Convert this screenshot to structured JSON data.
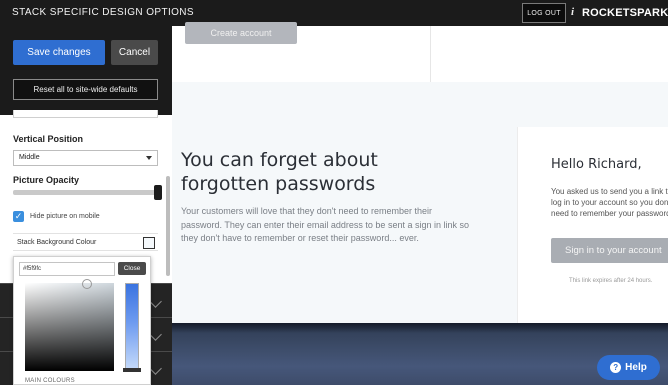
{
  "topbar": {
    "title": "STACK SPECIFIC DESIGN OPTIONS",
    "logout_label": "LOG OUT",
    "info_icon": "i",
    "brand": "ROCKETSPARK"
  },
  "sidebar": {
    "save_label": "Save changes",
    "cancel_label": "Cancel",
    "reset_label": "Reset all to site-wide defaults",
    "vertical_position_label": "Vertical Position",
    "vertical_position_value": "Middle",
    "picture_opacity_label": "Picture Opacity",
    "picture_opacity_value": 1.0,
    "hide_on_mobile_label": "Hide picture on mobile",
    "hide_on_mobile_checked": true,
    "stack_bg_label": "Stack Background Colour",
    "stack_bg_color": "#f5f9fc"
  },
  "picker": {
    "hex_value": "#f5f9fc",
    "close_label": "Close",
    "main_colours_label": "MAIN COLOURS"
  },
  "canvas": {
    "create_account_label": "Create account",
    "heading": "You can forget about forgotten passwords",
    "body": "Your customers will love that they don't need to remember their password. They can enter their email address to be sent a sign in link so they don't have to remember or reset their password... ever.",
    "card_greeting": "Hello Richard,",
    "card_text": "You asked us to send you a link to log in to your account so you don't need to remember your password.",
    "card_button": "Sign in to your account",
    "card_expiry": "This link expires after 24 hours."
  },
  "help": {
    "label": "Help",
    "icon": "?"
  },
  "colors": {
    "accent": "#2f6ed1",
    "topbar": "#1b1b1b",
    "stack_bg": "#f5f8fa"
  }
}
